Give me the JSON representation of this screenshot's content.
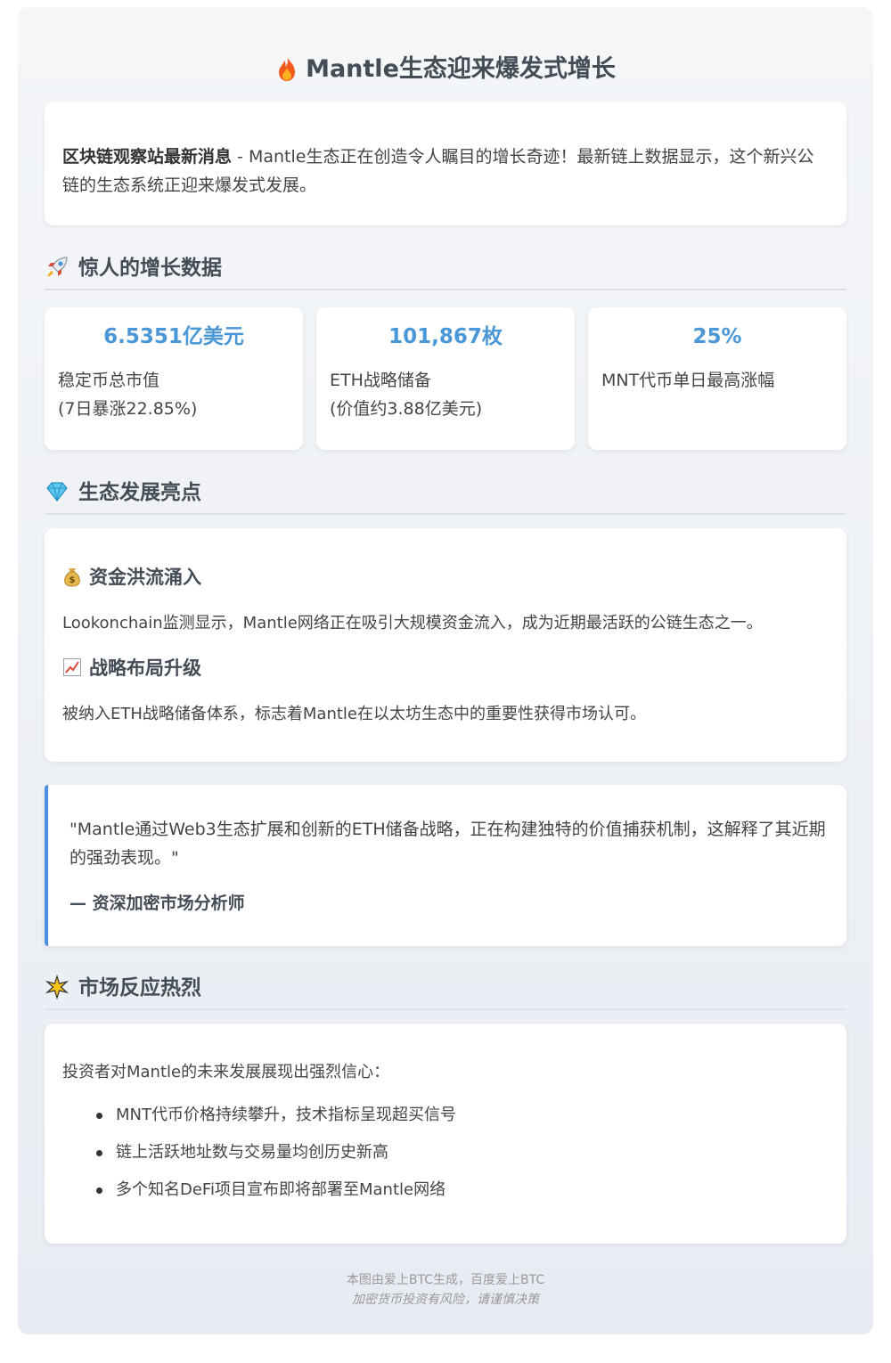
{
  "title": "Mantle生态迎来爆发式增长",
  "intro": {
    "lead": "区块链观察站最新消息",
    "text": " - Mantle生态正在创造令人瞩目的增长奇迹！最新链上数据显示，这个新兴公链的生态系统正迎来爆发式发展。"
  },
  "growth": {
    "heading": "惊人的增长数据",
    "stats": [
      {
        "value": "6.5351亿美元",
        "label1": "稳定币总市值",
        "label2": "(7日暴涨22.85%)"
      },
      {
        "value": "101,867枚",
        "label1": "ETH战略储备",
        "label2": "(价值约3.88亿美元)"
      },
      {
        "value": "25%",
        "label1": "MNT代币单日最高涨幅",
        "label2": ""
      }
    ]
  },
  "highlights": {
    "heading": "生态发展亮点",
    "items": [
      {
        "title": "资金洪流涌入",
        "icon": "money-bag-icon",
        "text": "Lookonchain监测显示，Mantle网络正在吸引大规模资金流入，成为近期最活跃的公链生态之一。"
      },
      {
        "title": "战略布局升级",
        "icon": "chart-up-icon",
        "text": "被纳入ETH战略储备体系，标志着Mantle在以太坊生态中的重要性获得市场认可。"
      }
    ]
  },
  "quote": {
    "text": "\"Mantle通过Web3生态扩展和创新的ETH储备战略，正在构建独特的价值捕获机制，这解释了其近期的强劲表现。\"",
    "author": "— 资深加密市场分析师"
  },
  "market": {
    "heading": "市场反应热烈",
    "intro": "投资者对Mantle的未来发展展现出强烈信心：",
    "bullets": [
      "MNT代币价格持续攀升，技术指标呈现超买信号",
      "链上活跃地址数与交易量均创历史新高",
      "多个知名DeFi项目宣布即将部署至Mantle网络"
    ]
  },
  "footer": {
    "line1": "本图由爱上BTC生成，百度爱上BTC",
    "line2": "加密货币投资有风险，请谨慎决策"
  },
  "colors": {
    "accent": "#4a97d8",
    "quote_border": "#4a90e2",
    "heading": "#444c56"
  }
}
